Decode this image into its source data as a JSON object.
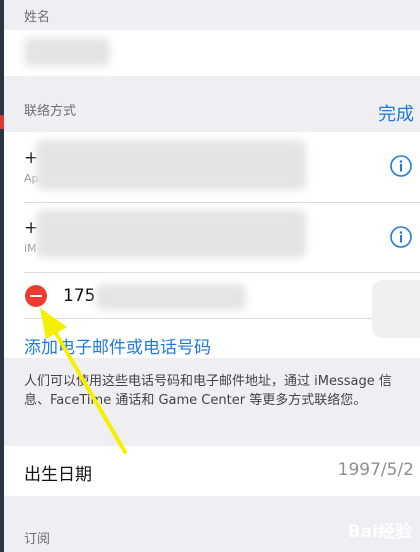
{
  "name_section": {
    "label": "姓名"
  },
  "contact_section": {
    "label": "联络方式",
    "done_label": "完成",
    "entries": [
      {
        "prefix": "+",
        "sublabel": "Ap"
      },
      {
        "prefix": "+",
        "sublabel": "iM"
      }
    ],
    "editing_phone_prefix": "175",
    "add_link_label": "添加电子邮件或电话号码",
    "footnote": "人们可以使用这些电话号码和电子邮件地址，通过 iMessage 信息、FaceTime 通话和 Game Center 等更多方式联络您。"
  },
  "birthday": {
    "label": "出生日期",
    "value": "1997/5/2"
  },
  "subscription_section": {
    "label": "订阅"
  },
  "watermark": "Bai经验",
  "colors": {
    "accent": "#1f7ae0",
    "delete": "#ee3b32",
    "annotation_arrow": "#f5f000"
  }
}
